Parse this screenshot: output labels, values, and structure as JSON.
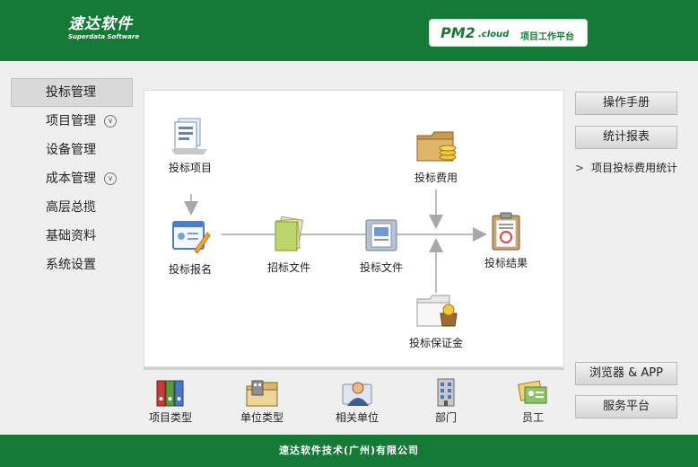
{
  "header": {
    "logo_cn": "速达软件",
    "logo_en": "Superdata Software",
    "product_main": "PM2",
    "product_cloud": ".cloud",
    "product_subtitle": "项目工作平台",
    "bg_color": "#147a36"
  },
  "nav": {
    "items": [
      {
        "label": "投标管理",
        "active": true
      },
      {
        "label": "项目管理",
        "expandable": true
      },
      {
        "label": "设备管理"
      },
      {
        "label": "成本管理",
        "expandable": true
      },
      {
        "label": "高层总揽"
      },
      {
        "label": "基础资料"
      },
      {
        "label": "系统设置"
      }
    ]
  },
  "flow": {
    "nodes": [
      {
        "label": "投标项目",
        "icon": "document-stack-icon"
      },
      {
        "label": "投标报名",
        "icon": "form-pencil-icon"
      },
      {
        "label": "招标文件",
        "icon": "paper-stack-icon"
      },
      {
        "label": "投标文件",
        "icon": "document-folder-icon"
      },
      {
        "label": "投标费用",
        "icon": "money-folder-icon"
      },
      {
        "label": "投标结果",
        "icon": "clipboard-stamp-icon"
      },
      {
        "label": "投标保证金",
        "icon": "deposit-folder-icon"
      }
    ]
  },
  "right": {
    "manual": "操作手册",
    "report": "统计报表",
    "report_link": "项目投标费用统计",
    "browser_app": "浏览器 & APP",
    "service": "服务平台"
  },
  "tools": [
    {
      "label": "项目类型",
      "icon": "binders-icon"
    },
    {
      "label": "单位类型",
      "icon": "building-folder-icon"
    },
    {
      "label": "相关单位",
      "icon": "person-card-icon"
    },
    {
      "label": "部门",
      "icon": "office-building-icon"
    },
    {
      "label": "员工",
      "icon": "id-cards-icon"
    }
  ],
  "footer": {
    "company": "速达软件技术(广州)有限公司"
  }
}
